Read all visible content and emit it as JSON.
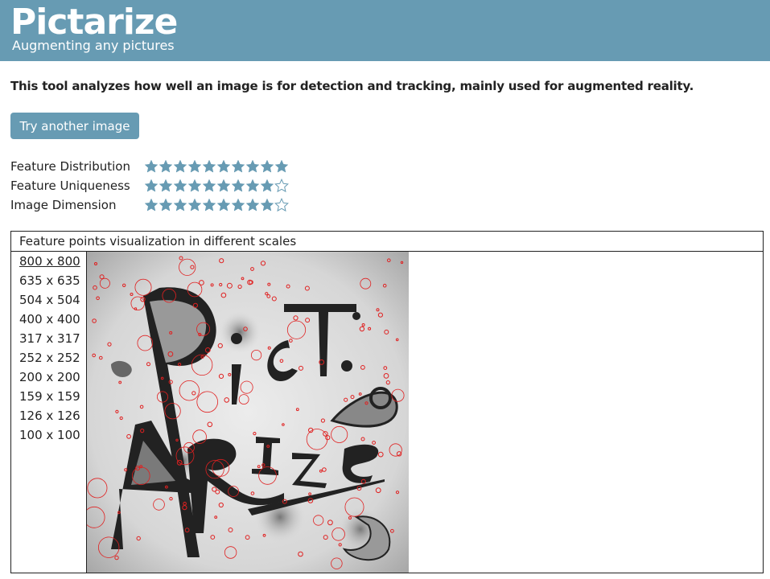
{
  "header": {
    "brand": "Pictarize",
    "tagline": "Augmenting any pictures",
    "color": "#679bb3"
  },
  "description": "This tool analyzes how well an image is for detection and tracking, mainly used for augmented reality.",
  "try_button": {
    "label": "Try another image"
  },
  "ratings": [
    {
      "label": "Feature Distribution",
      "score": 10,
      "max": 10
    },
    {
      "label": "Feature Uniqueness",
      "score": 9,
      "max": 10
    },
    {
      "label": "Image Dimension",
      "score": 9,
      "max": 10
    }
  ],
  "star_color": "#679bb3",
  "visualization": {
    "title": "Feature points visualization in different scales",
    "scales": [
      "800 x 800",
      "635 x 635",
      "504 x 504",
      "400 x 400",
      "317 x 317",
      "252 x 252",
      "200 x 200",
      "159 x 159",
      "126 x 126",
      "100 x 100"
    ],
    "selected_scale": "800 x 800",
    "image_alt": "Feature points overlay on Pictarize artwork",
    "feature_marker_color": "#e02020"
  }
}
